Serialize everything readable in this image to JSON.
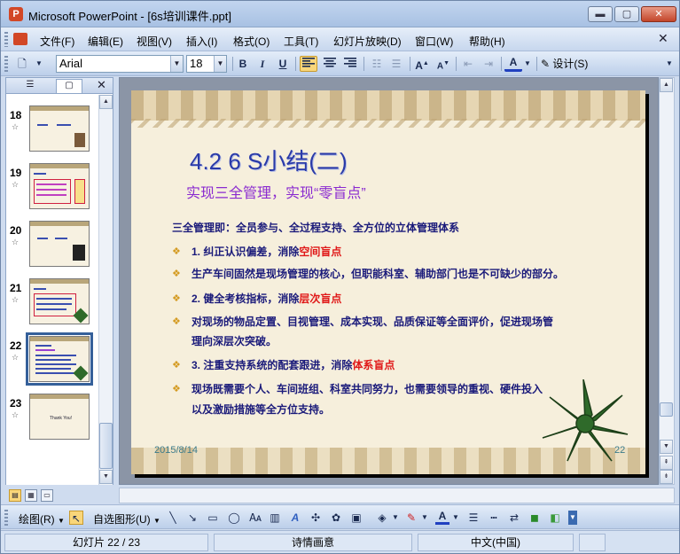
{
  "window": {
    "title": "Microsoft PowerPoint - [6s培训课件.ppt]",
    "app_icon_letter": "P",
    "controls": {
      "minimize": "▬",
      "maximize": "▢",
      "close": "✕"
    }
  },
  "menubar": {
    "items": [
      "文件(F)",
      "编辑(E)",
      "视图(V)",
      "插入(I)",
      "格式(O)",
      "工具(T)",
      "幻灯片放映(D)",
      "窗口(W)",
      "帮助(H)"
    ],
    "close_glyph": "✕"
  },
  "toolbar": {
    "font_name": "Arial",
    "font_size": "18",
    "bold": "B",
    "italic": "I",
    "underline": "U",
    "design_label": "设计(S)"
  },
  "outline_pane": {
    "close_glyph": "✕",
    "slides": [
      {
        "number": "18",
        "caption": ""
      },
      {
        "number": "19",
        "caption": ""
      },
      {
        "number": "20",
        "caption": ""
      },
      {
        "number": "21",
        "caption": ""
      },
      {
        "number": "22",
        "caption": "",
        "selected": true
      },
      {
        "number": "23",
        "caption": "Thank You!"
      }
    ]
  },
  "slide": {
    "title": "4.2      6 S小结(二)",
    "subtitle": "实现三全管理，实现“零盲点”",
    "lead": "三全管理即：全员参与、全过程支持、全方位的立体管理体系",
    "bullets": [
      {
        "mark": "❖",
        "prefix": "1. 纠正认识偏差，消除",
        "highlight": "空间盲点",
        "suffix": ""
      },
      {
        "mark": "❖",
        "prefix": "        生产车间固然是现场管理的核心，但职能科室、辅助部门也是不可缺少的部分。",
        "highlight": "",
        "suffix": ""
      },
      {
        "mark": "❖",
        "prefix": "2. 健全考核指标，消除",
        "highlight": "层次盲点",
        "suffix": ""
      },
      {
        "mark": "❖",
        "prefix": "     对现场的物品定置、目视管理、成本实现、品质保证等全面评价，促进现场管",
        "highlight": "",
        "suffix": ""
      },
      {
        "mark": "",
        "prefix": "理向深层次突破。",
        "highlight": "",
        "suffix": ""
      },
      {
        "mark": "❖",
        "prefix": "3. 注重支持系统的配套跟进，消除",
        "highlight": "体系盲点",
        "suffix": ""
      },
      {
        "mark": "❖",
        "prefix": "          现场既需要个人、车间班组、科室共同努力，也需要领导的重视、硬件投入",
        "highlight": "",
        "suffix": ""
      },
      {
        "mark": "",
        "prefix": "以及激励措施等全方位支持。",
        "highlight": "",
        "suffix": ""
      }
    ],
    "date": "2015/8/14",
    "page_number": "22"
  },
  "drawing_toolbar": {
    "draw_label": "绘图(R)",
    "autoshape_label": "自选图形(U)"
  },
  "statusbar": {
    "slide_position": "幻灯片 22 / 23",
    "design_name": "诗情画意",
    "language": "中文(中国)"
  },
  "colors": {
    "title_blue": "#2a3aa8",
    "subtitle_purple": "#8a2ad0",
    "body_navy": "#1a1a7a",
    "highlight_red": "#e01818",
    "bullet_gold": "#d49a20",
    "leaf_green": "#2f6a2a"
  }
}
